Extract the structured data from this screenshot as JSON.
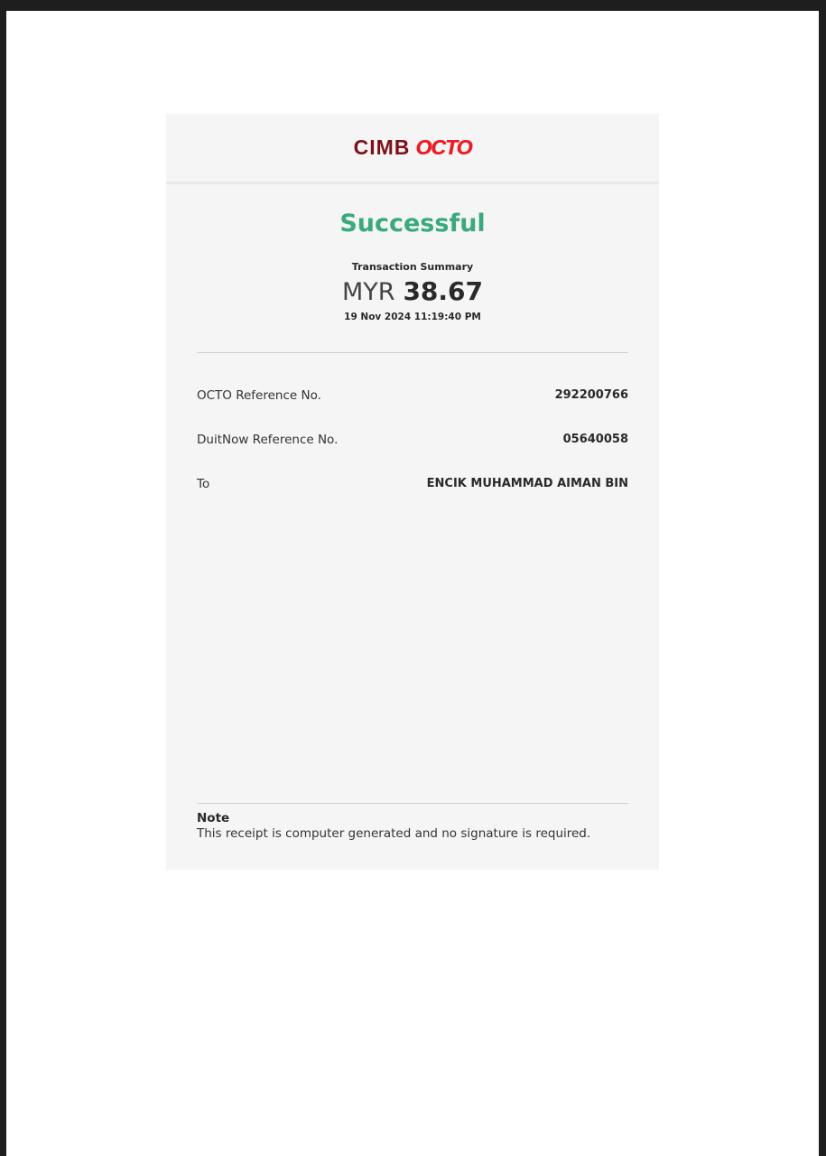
{
  "brand": {
    "name_part1": "CIMB",
    "name_part2": "OCTO",
    "colors": {
      "primary": "#7d1019",
      "accent": "#ec1c24"
    }
  },
  "status": {
    "text": "Successful",
    "color": "#3aaa7c"
  },
  "summary": {
    "label": "Transaction Summary",
    "currency": "MYR",
    "amount": "38.67",
    "datetime": "19 Nov 2024 11:19:40 PM"
  },
  "details": [
    {
      "label": "OCTO Reference No.",
      "value": "292200766"
    },
    {
      "label": "DuitNow Reference No.",
      "value": "05640058"
    },
    {
      "label": "To",
      "value": "ENCIK MUHAMMAD AIMAN BIN"
    }
  ],
  "note": {
    "title": "Note",
    "text": "This receipt is computer generated and no signature is required."
  }
}
